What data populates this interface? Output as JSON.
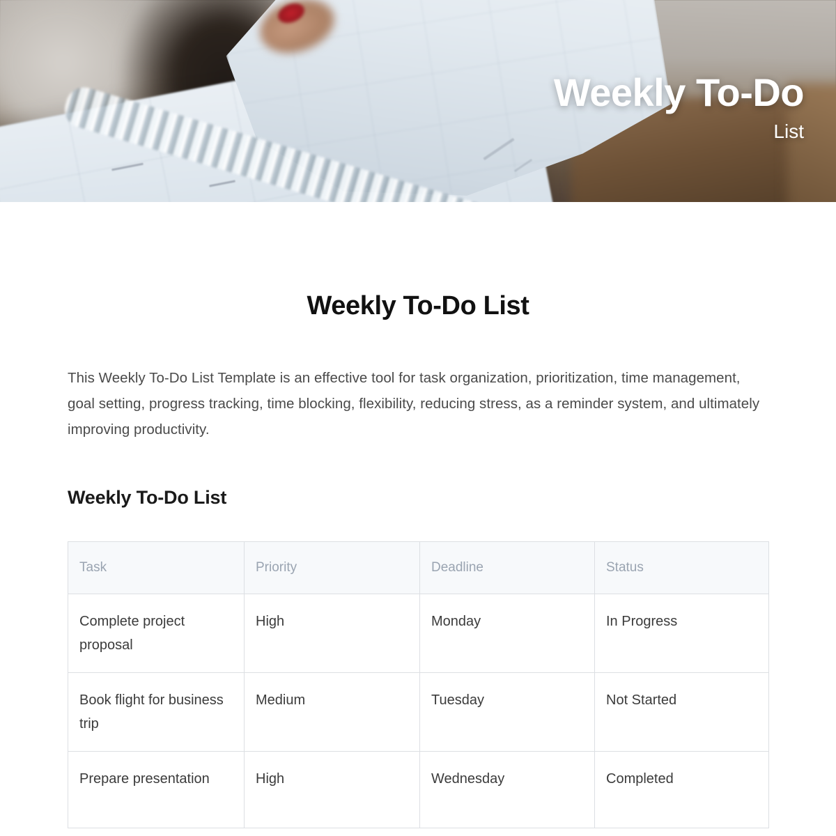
{
  "hero": {
    "title": "Weekly To-Do",
    "subtitle": "List",
    "image_alt": "spiral-notebook-planner-photo"
  },
  "document": {
    "title": "Weekly To-Do List",
    "intro": "This Weekly To-Do List Template is an effective tool for task organization, prioritization, time management, goal setting, progress tracking, time blocking, flexibility, reducing stress, as a reminder system, and ultimately improving productivity.",
    "section_title": "Weekly To-Do List"
  },
  "table": {
    "columns": [
      "Task",
      "Priority",
      "Deadline",
      "Status"
    ],
    "rows": [
      {
        "task": "Complete project proposal",
        "priority": "High",
        "deadline": "Monday",
        "status": "In Progress"
      },
      {
        "task": "Book flight for business trip",
        "priority": "Medium",
        "deadline": "Tuesday",
        "status": "Not Started"
      },
      {
        "task": "Prepare presentation",
        "priority": "High",
        "deadline": "Wednesday",
        "status": "Completed"
      }
    ]
  },
  "colors": {
    "page_background": "#ffffff",
    "heading_text": "#111111",
    "body_text": "#4a4a4a",
    "table_header_background": "#f7f9fb",
    "table_header_text": "#9aa4b1",
    "table_cell_text": "#3b3b3b",
    "table_border": "#dcdfe3",
    "hero_title_text": "#ffffff"
  }
}
